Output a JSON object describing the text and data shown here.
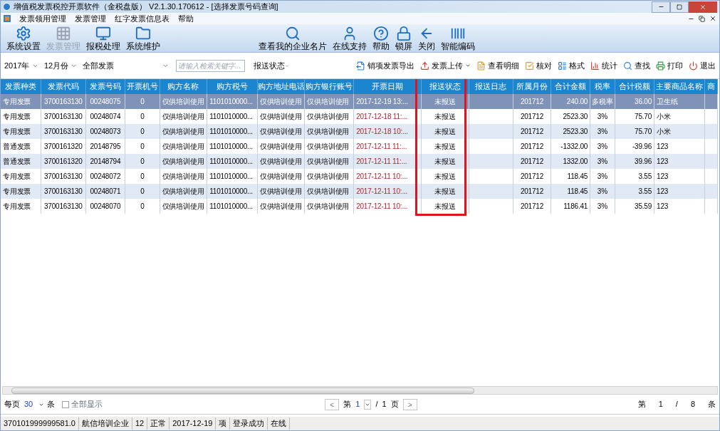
{
  "window": {
    "title": "增值税发票税控开票软件（金税盘版） V2.1.30.170612 - [选择发票号码查询]"
  },
  "menu": [
    "发票领用管理",
    "发票管理",
    "红字发票信息表",
    "帮助"
  ],
  "toolbar_left": [
    {
      "label": "系统设置",
      "disabled": false
    },
    {
      "label": "发票管理",
      "disabled": true
    },
    {
      "label": "报税处理",
      "disabled": false
    },
    {
      "label": "系统维护",
      "disabled": false
    }
  ],
  "toolbar_right": [
    {
      "label": "查看我的企业名片",
      "disabled": false
    },
    {
      "label": "在线支持",
      "disabled": false
    },
    {
      "label": "帮助",
      "disabled": false
    },
    {
      "label": "锁屏",
      "disabled": false
    },
    {
      "label": "关闭",
      "disabled": false
    },
    {
      "label": "智能编码",
      "disabled": false
    }
  ],
  "filters": {
    "year": "2017年",
    "month": "12月份",
    "invoice_scope": "全部发票",
    "search": {
      "placeholder": "请输入检索关键字..."
    },
    "status": "报送状态"
  },
  "actions": [
    {
      "label": "销项发票导出",
      "caret": false
    },
    {
      "label": "发票上传",
      "caret": true
    },
    {
      "label": "查看明细",
      "caret": false
    },
    {
      "label": "核对",
      "caret": false
    },
    {
      "label": "格式",
      "caret": false
    },
    {
      "label": "统计",
      "caret": false
    },
    {
      "label": "查找",
      "caret": false
    },
    {
      "label": "打印",
      "caret": false
    },
    {
      "label": "退出",
      "caret": false
    }
  ],
  "table": {
    "columns": [
      {
        "label": "发票种类",
        "kind": "text",
        "highlighted": false
      },
      {
        "label": "发票代码",
        "kind": "code",
        "highlighted": false
      },
      {
        "label": "发票号码",
        "kind": "code",
        "highlighted": false
      },
      {
        "label": "开票机号",
        "kind": "code",
        "highlighted": false
      },
      {
        "label": "购方名称",
        "kind": "text",
        "highlighted": false
      },
      {
        "label": "购方税号",
        "kind": "text",
        "highlighted": false
      },
      {
        "label": "购方地址电话",
        "kind": "text",
        "highlighted": false
      },
      {
        "label": "购方银行账号",
        "kind": "text",
        "highlighted": false
      },
      {
        "label": "开票日期",
        "kind": "date",
        "highlighted": false
      },
      {
        "label": "报送状态",
        "kind": "code",
        "highlighted": true
      },
      {
        "label": "报送日志",
        "kind": "text",
        "highlighted": false
      },
      {
        "label": "所属月份",
        "kind": "code",
        "highlighted": false
      },
      {
        "label": "合计金额",
        "kind": "amount",
        "highlighted": false
      },
      {
        "label": "税率",
        "kind": "code",
        "highlighted": false
      },
      {
        "label": "合计税额",
        "kind": "amount",
        "highlighted": false
      },
      {
        "label": "主要商品名称",
        "kind": "text",
        "highlighted": false
      },
      {
        "label": "商",
        "kind": "text",
        "highlighted": false
      }
    ],
    "rows": [
      {
        "selected": true,
        "cells": {
          "type": "专用发票",
          "code": "3700163130",
          "number": "00248075",
          "machine": "0",
          "buyer": "仅供培训使用",
          "tax_id": "1101010000...",
          "address": "仅供培训使用",
          "bank": "仅供培训使用",
          "date": "2017-12-19 13:...",
          "status": "未报送",
          "month": "201712",
          "amount": "240.00",
          "rate": "多税率",
          "tax": "36.00",
          "goods": "卫生纸"
        }
      },
      {
        "selected": false,
        "cells": {
          "type": "专用发票",
          "code": "3700163130",
          "number": "00248074",
          "machine": "0",
          "buyer": "仅供培训使用",
          "tax_id": "1101010000...",
          "address": "仅供培训使用",
          "bank": "仅供培训使用",
          "date": "2017-12-18 11:...",
          "status": "未报送",
          "month": "201712",
          "amount": "2523.30",
          "rate": "3%",
          "tax": "75.70",
          "goods": "小米"
        }
      },
      {
        "selected": false,
        "cells": {
          "type": "专用发票",
          "code": "3700163130",
          "number": "00248073",
          "machine": "0",
          "buyer": "仅供培训使用",
          "tax_id": "1101010000...",
          "address": "仅供培训使用",
          "bank": "仅供培训使用",
          "date": "2017-12-18 10:...",
          "status": "未报送",
          "month": "201712",
          "amount": "2523.30",
          "rate": "3%",
          "tax": "75.70",
          "goods": "小米"
        }
      },
      {
        "selected": false,
        "cells": {
          "type": "普通发票",
          "code": "3700161320",
          "number": "20148795",
          "machine": "0",
          "buyer": "仅供培训使用",
          "tax_id": "1101010000...",
          "address": "仅供培训使用",
          "bank": "仅供培训使用",
          "date": "2017-12-11 11:...",
          "status": "未报送",
          "month": "201712",
          "amount": "-1332.00",
          "rate": "3%",
          "tax": "-39.96",
          "goods": "123"
        }
      },
      {
        "selected": false,
        "cells": {
          "type": "普通发票",
          "code": "3700161320",
          "number": "20148794",
          "machine": "0",
          "buyer": "仅供培训使用",
          "tax_id": "1101010000...",
          "address": "仅供培训使用",
          "bank": "仅供培训使用",
          "date": "2017-12-11 11:...",
          "status": "未报送",
          "month": "201712",
          "amount": "1332.00",
          "rate": "3%",
          "tax": "39.96",
          "goods": "123"
        }
      },
      {
        "selected": false,
        "cells": {
          "type": "专用发票",
          "code": "3700163130",
          "number": "00248072",
          "machine": "0",
          "buyer": "仅供培训使用",
          "tax_id": "1101010000...",
          "address": "仅供培训使用",
          "bank": "仅供培训使用",
          "date": "2017-12-11 10:...",
          "status": "未报送",
          "month": "201712",
          "amount": "118.45",
          "rate": "3%",
          "tax": "3.55",
          "goods": "123"
        }
      },
      {
        "selected": false,
        "cells": {
          "type": "专用发票",
          "code": "3700163130",
          "number": "00248071",
          "machine": "0",
          "buyer": "仅供培训使用",
          "tax_id": "1101010000...",
          "address": "仅供培训使用",
          "bank": "仅供培训使用",
          "date": "2017-12-11 10:...",
          "status": "未报送",
          "month": "201712",
          "amount": "118.45",
          "rate": "3%",
          "tax": "3.55",
          "goods": "123"
        }
      },
      {
        "selected": false,
        "cells": {
          "type": "专用发票",
          "code": "3700163130",
          "number": "00248070",
          "machine": "0",
          "buyer": "仅供培训使用",
          "tax_id": "1101010000...",
          "address": "仅供培训使用",
          "bank": "仅供培训使用",
          "date": "2017-12-11 10:...",
          "status": "未报送",
          "month": "201712",
          "amount": "1186.41",
          "rate": "3%",
          "tax": "35.59",
          "goods": "123"
        }
      }
    ]
  },
  "pager": {
    "per_page_label": "每页",
    "per_page": "30",
    "per_page_unit": "条",
    "show_all": {
      "label": "全部显示",
      "checked": false
    },
    "prev": "<",
    "page_prefix": "第",
    "page": "1",
    "page_sep": "/",
    "page_total": "1",
    "page_unit": "页",
    "next": ">",
    "record_prefix": "第",
    "record": "1",
    "record_sep": "/",
    "record_total": "8",
    "record_unit": "条"
  },
  "status_bar": [
    "370101999999581.0",
    "航信培训企业",
    "12",
    "正常",
    "2017-12-19",
    "项",
    "登录成功",
    "在线"
  ]
}
